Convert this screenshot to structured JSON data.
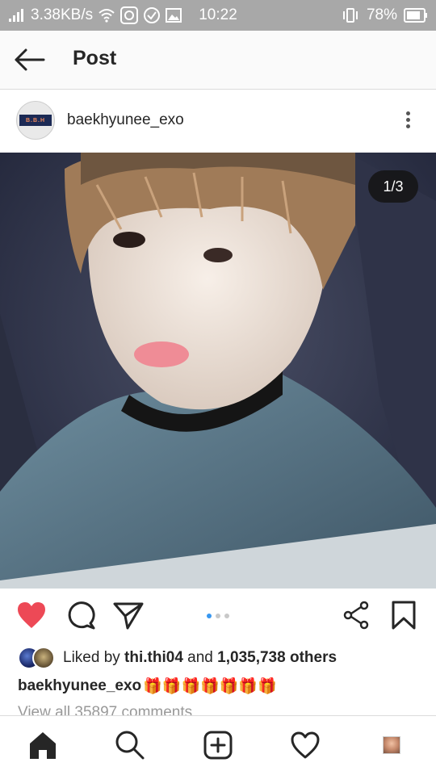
{
  "status_bar": {
    "network_speed": "3.38KB/s",
    "time": "10:22",
    "battery": "78%"
  },
  "header": {
    "title": "Post",
    "back_icon": "back-arrow-icon"
  },
  "post": {
    "username": "baekhyunee_exo",
    "avatar_text": "B.B.H",
    "counter": "1/3",
    "current_slide": 1,
    "total_slides": 3,
    "liked": true,
    "likes_prefix": "Liked by ",
    "liked_by_user": "thi.thi04",
    "likes_middle": " and ",
    "likes_count": "1,035,738 others",
    "caption_user": "baekhyunee_exo",
    "caption_gifts": "🎁🎁🎁🎁🎁🎁🎁",
    "view_comments": "View all 35897 comments"
  },
  "colors": {
    "like_red": "#ed4956",
    "dot_active": "#3897f0",
    "status_bar": "#a8a8a8"
  },
  "bottom_nav": [
    {
      "icon": "home-icon"
    },
    {
      "icon": "search-icon"
    },
    {
      "icon": "add-post-icon"
    },
    {
      "icon": "activity-heart-icon"
    },
    {
      "icon": "profile-icon"
    }
  ]
}
